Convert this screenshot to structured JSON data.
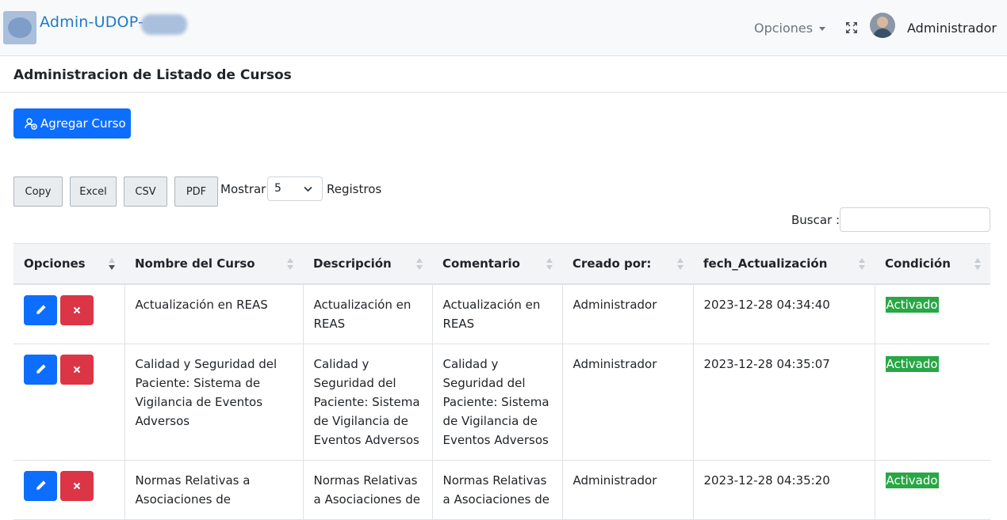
{
  "header": {
    "brand": "Admin-UDOP-",
    "menu_label": "Opciones",
    "user_name": "Administrador"
  },
  "page": {
    "title": "Administracion de Listado de Cursos",
    "add_button": "Agregar Curso"
  },
  "toolbar": {
    "export_buttons": [
      "Copy",
      "Excel",
      "CSV",
      "PDF"
    ],
    "show_label": "Mostrar",
    "page_size": "5",
    "records_label": "Registros",
    "search_label": "Buscar :",
    "search_value": ""
  },
  "table": {
    "columns": [
      "Opciones",
      "Nombre del Curso",
      "Descripción",
      "Comentario",
      "Creado por:",
      "fech_Actualización",
      "Condición"
    ],
    "rows": [
      {
        "nombre": "Actualización en REAS",
        "descripcion": "Actualización en REAS",
        "comentario": "Actualización en REAS",
        "creado": "Administrador",
        "fecha": "2023-12-28 04:34:40",
        "condicion": "Activado"
      },
      {
        "nombre": "Calidad y Seguridad del Paciente: Sistema de Vigilancia de Eventos Adversos",
        "descripcion": "Calidad y Seguridad del Paciente: Sistema de Vigilancia de Eventos Adversos",
        "comentario": "Calidad y Seguridad del Paciente: Sistema de Vigilancia de Eventos Adversos",
        "creado": "Administrador",
        "fecha": "2023-12-28 04:35:07",
        "condicion": "Activado"
      },
      {
        "nombre": "Normas Relativas a Asociaciones de",
        "descripcion": "Normas Relativas a Asociaciones de",
        "comentario": "Normas Relativas a Asociaciones de",
        "creado": "Administrador",
        "fecha": "2023-12-28 04:35:20",
        "condicion": "Activado"
      }
    ]
  },
  "colors": {
    "primary": "#0d6efd",
    "danger": "#dc3545",
    "success": "#28a745",
    "brand": "#1f7ac9"
  }
}
